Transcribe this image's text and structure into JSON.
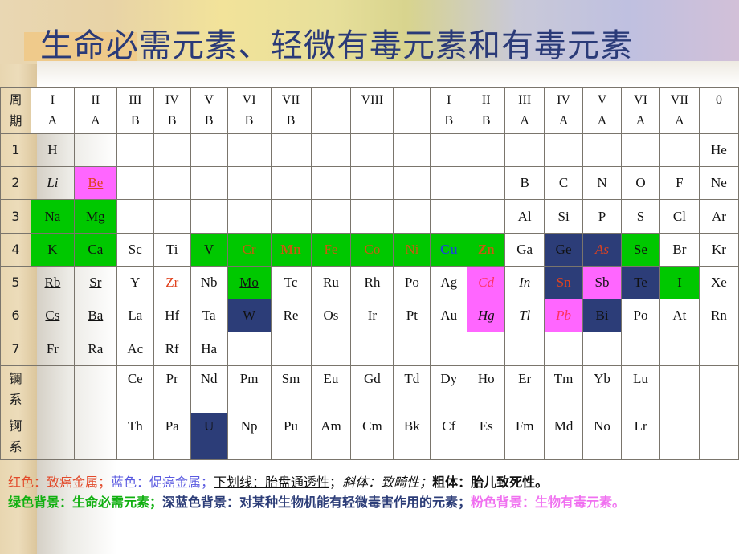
{
  "title": "生命必需元素、轻微有毒元素和有毒元素",
  "colors": {
    "green_bg": "#00c800",
    "navy_bg": "#2c3d78",
    "pink_bg": "#ff66ff",
    "red_text": "#e0421e",
    "blue_text": "#1a4ad0",
    "title": "#2a3a78"
  },
  "table": {
    "period_header": [
      "周",
      "期"
    ],
    "group_headers": [
      [
        "I",
        "A"
      ],
      [
        "II",
        "A"
      ],
      [
        "III",
        "B"
      ],
      [
        "IV",
        "B"
      ],
      [
        "V",
        "B"
      ],
      [
        "VI",
        "B"
      ],
      [
        "VII",
        "B"
      ],
      [
        "",
        ""
      ],
      [
        "VIII",
        ""
      ],
      [
        "",
        ""
      ],
      [
        "I",
        "B"
      ],
      [
        "II",
        "B"
      ],
      [
        "III",
        "A"
      ],
      [
        "IV",
        "A"
      ],
      [
        "V",
        "A"
      ],
      [
        "VI",
        "A"
      ],
      [
        "VII",
        "A"
      ],
      [
        "0",
        ""
      ]
    ],
    "rows": [
      {
        "period": "1",
        "cells": [
          {
            "s": "H"
          },
          {},
          {},
          {},
          {},
          {},
          {},
          {},
          {},
          {},
          {},
          {},
          {},
          {},
          {},
          {},
          {},
          {
            "s": "He"
          }
        ]
      },
      {
        "period": "2",
        "cells": [
          {
            "s": "Li",
            "style": "italic"
          },
          {
            "s": "Be",
            "bg": "pink",
            "color": "red",
            "underline": true
          },
          {},
          {},
          {},
          {},
          {},
          {},
          {},
          {},
          {},
          {},
          {
            "s": "B"
          },
          {
            "s": "C"
          },
          {
            "s": "N"
          },
          {
            "s": "O"
          },
          {
            "s": "F"
          },
          {
            "s": "Ne"
          }
        ]
      },
      {
        "period": "3",
        "cells": [
          {
            "s": "Na",
            "bg": "green"
          },
          {
            "s": "Mg",
            "bg": "green"
          },
          {},
          {},
          {},
          {},
          {},
          {},
          {},
          {},
          {},
          {},
          {
            "s": "Al",
            "underline": true
          },
          {
            "s": "Si"
          },
          {
            "s": "P"
          },
          {
            "s": "S"
          },
          {
            "s": "Cl"
          },
          {
            "s": "Ar"
          }
        ]
      },
      {
        "period": "4",
        "cells": [
          {
            "s": "K",
            "bg": "green"
          },
          {
            "s": "Ca",
            "bg": "green",
            "underline": true
          },
          {
            "s": "Sc"
          },
          {
            "s": "Ti"
          },
          {
            "s": "V",
            "bg": "green"
          },
          {
            "s": "Cr",
            "bg": "green",
            "color": "orange",
            "underline": true
          },
          {
            "s": "Mn",
            "bg": "green",
            "color": "orange",
            "underline": true,
            "bold": true
          },
          {
            "s": "Fe",
            "bg": "green",
            "color": "orange",
            "underline": true
          },
          {
            "s": "Co",
            "bg": "green",
            "color": "orange",
            "underline": true
          },
          {
            "s": "Ni",
            "bg": "green",
            "color": "orange",
            "underline": true
          },
          {
            "s": "Cu",
            "bg": "green",
            "color": "blue",
            "bold": true
          },
          {
            "s": "Zn",
            "bg": "green",
            "color": "orange",
            "bold": true
          },
          {
            "s": "Ga"
          },
          {
            "s": "Ge",
            "bg": "navy"
          },
          {
            "s": "As",
            "bg": "navy",
            "color": "red",
            "style": "italic"
          },
          {
            "s": "Se",
            "bg": "green"
          },
          {
            "s": "Br"
          },
          {
            "s": "Kr"
          }
        ]
      },
      {
        "period": "5",
        "cells": [
          {
            "s": "Rb",
            "underline": true
          },
          {
            "s": "Sr",
            "underline": true
          },
          {
            "s": "Y"
          },
          {
            "s": "Zr",
            "color": "red"
          },
          {
            "s": "Nb"
          },
          {
            "s": "Mo",
            "bg": "green",
            "underline": true
          },
          {
            "s": "Tc"
          },
          {
            "s": "Ru"
          },
          {
            "s": "Rh"
          },
          {
            "s": "Po"
          },
          {
            "s": "Ag"
          },
          {
            "s": "Cd",
            "bg": "pink",
            "color": "pinkred",
            "style": "italic"
          },
          {
            "s": "In",
            "style": "italic"
          },
          {
            "s": "Sn",
            "bg": "navy",
            "color": "red"
          },
          {
            "s": "Sb",
            "bg": "pink"
          },
          {
            "s": "Te",
            "bg": "navy"
          },
          {
            "s": "I",
            "bg": "green"
          },
          {
            "s": "Xe"
          }
        ]
      },
      {
        "period": "6",
        "cells": [
          {
            "s": "Cs",
            "underline": true
          },
          {
            "s": "Ba",
            "underline": true
          },
          {
            "s": "La"
          },
          {
            "s": "Hf"
          },
          {
            "s": "Ta"
          },
          {
            "s": "W",
            "bg": "navy"
          },
          {
            "s": "Re"
          },
          {
            "s": "Os"
          },
          {
            "s": "Ir"
          },
          {
            "s": "Pt"
          },
          {
            "s": "Au"
          },
          {
            "s": "Hg",
            "bg": "pink",
            "style": "italic"
          },
          {
            "s": "Tl",
            "style": "italic"
          },
          {
            "s": "Pb",
            "bg": "pink",
            "color": "pinkred",
            "style": "italic"
          },
          {
            "s": "Bi",
            "bg": "navy"
          },
          {
            "s": "Po"
          },
          {
            "s": "At"
          },
          {
            "s": "Rn"
          }
        ]
      },
      {
        "period": "7",
        "cells": [
          {
            "s": "Fr"
          },
          {
            "s": "Ra"
          },
          {
            "s": "Ac"
          },
          {
            "s": "Rf"
          },
          {
            "s": "Ha"
          },
          {},
          {},
          {},
          {},
          {},
          {},
          {},
          {},
          {},
          {},
          {},
          {},
          {}
        ]
      },
      {
        "period": "镧系",
        "tall": true,
        "cells": [
          {},
          {},
          {
            "s": "Ce"
          },
          {
            "s": "Pr"
          },
          {
            "s": "Nd"
          },
          {
            "s": "Pm"
          },
          {
            "s": "Sm"
          },
          {
            "s": "Eu"
          },
          {
            "s": "Gd"
          },
          {
            "s": "Td"
          },
          {
            "s": "Dy"
          },
          {
            "s": "Ho"
          },
          {
            "s": "Er"
          },
          {
            "s": "Tm"
          },
          {
            "s": "Yb"
          },
          {
            "s": "Lu"
          },
          {},
          {}
        ]
      },
      {
        "period": "锕系",
        "tall": true,
        "cells": [
          {},
          {},
          {
            "s": "Th"
          },
          {
            "s": "Pa"
          },
          {
            "s": "U",
            "bg": "navy"
          },
          {
            "s": "Np"
          },
          {
            "s": "Pu"
          },
          {
            "s": "Am"
          },
          {
            "s": "Cm"
          },
          {
            "s": "Bk"
          },
          {
            "s": "Cf"
          },
          {
            "s": "Es"
          },
          {
            "s": "Fm"
          },
          {
            "s": "Md"
          },
          {
            "s": "No"
          },
          {
            "s": "Lr"
          },
          {},
          {}
        ]
      }
    ]
  },
  "legend": {
    "red": "红色：致癌金属；",
    "blue": "蓝色：促癌金属；",
    "underline": "下划线：胎盘通透性",
    "sep1": "；",
    "italic": "斜体：致畸性；",
    "bold": "粗体：胎儿致死性。",
    "green_bg": "绿色背景：生命必需元素；",
    "navy_bg": "深蓝色背景：对某种生物机能有轻微毒害作用的元素；",
    "pink_bg": "粉色背景：生物有毒元素。"
  }
}
